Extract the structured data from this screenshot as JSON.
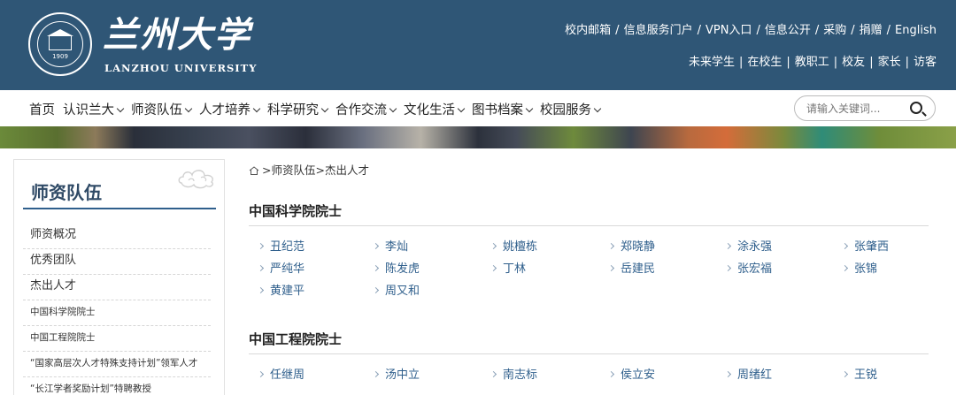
{
  "header": {
    "logo_cn": "兰州大学",
    "logo_en": "LANZHOU UNIVERSITY",
    "seal_year": "1909",
    "top_links": [
      "校内邮箱",
      "信息服务门户",
      "VPN入口",
      "信息公开",
      "采购",
      "捐赠",
      "English"
    ],
    "audience_links": [
      "未来学生",
      "在校生",
      "教职工",
      "校友",
      "家长",
      "访客"
    ]
  },
  "nav": {
    "items": [
      {
        "label": "首页",
        "dropdown": false
      },
      {
        "label": "认识兰大",
        "dropdown": true
      },
      {
        "label": "师资队伍",
        "dropdown": true
      },
      {
        "label": "人才培养",
        "dropdown": true
      },
      {
        "label": "科学研究",
        "dropdown": true
      },
      {
        "label": "合作交流",
        "dropdown": true
      },
      {
        "label": "文化生活",
        "dropdown": true
      },
      {
        "label": "图书档案",
        "dropdown": true
      },
      {
        "label": "校园服务",
        "dropdown": true
      }
    ],
    "search_placeholder": "请输入关键词..."
  },
  "sidebar": {
    "title": "师资队伍",
    "items": [
      {
        "label": "师资概况",
        "sub": false
      },
      {
        "label": "优秀团队",
        "sub": false
      },
      {
        "label": "杰出人才",
        "sub": false
      },
      {
        "label": "中国科学院院士",
        "sub": true
      },
      {
        "label": "中国工程院院士",
        "sub": true
      },
      {
        "label": "“国家高层次人才特殊支持计划”领军人才",
        "sub": true
      },
      {
        "label": "“长江学者奖励计划”特聘教授",
        "sub": true
      }
    ]
  },
  "breadcrumb": {
    "parts": [
      "师资队伍",
      "杰出人才"
    ]
  },
  "sections": [
    {
      "title": "中国科学院院士",
      "names": [
        "丑纪范",
        "李灿",
        "姚檀栋",
        "郑晓静",
        "涂永强",
        "张肇西",
        "严纯华",
        "陈发虎",
        "丁林",
        "岳建民",
        "张宏福",
        "张锦",
        "黄建平",
        "周又和"
      ]
    },
    {
      "title": "中国工程院院士",
      "names": [
        "任继周",
        "汤中立",
        "南志标",
        "侯立安",
        "周绪红",
        "王锐"
      ]
    }
  ],
  "colors": {
    "header_bg": "#2f5676",
    "link": "#2f5f8c",
    "sidebar_title": "#2f4a66"
  }
}
